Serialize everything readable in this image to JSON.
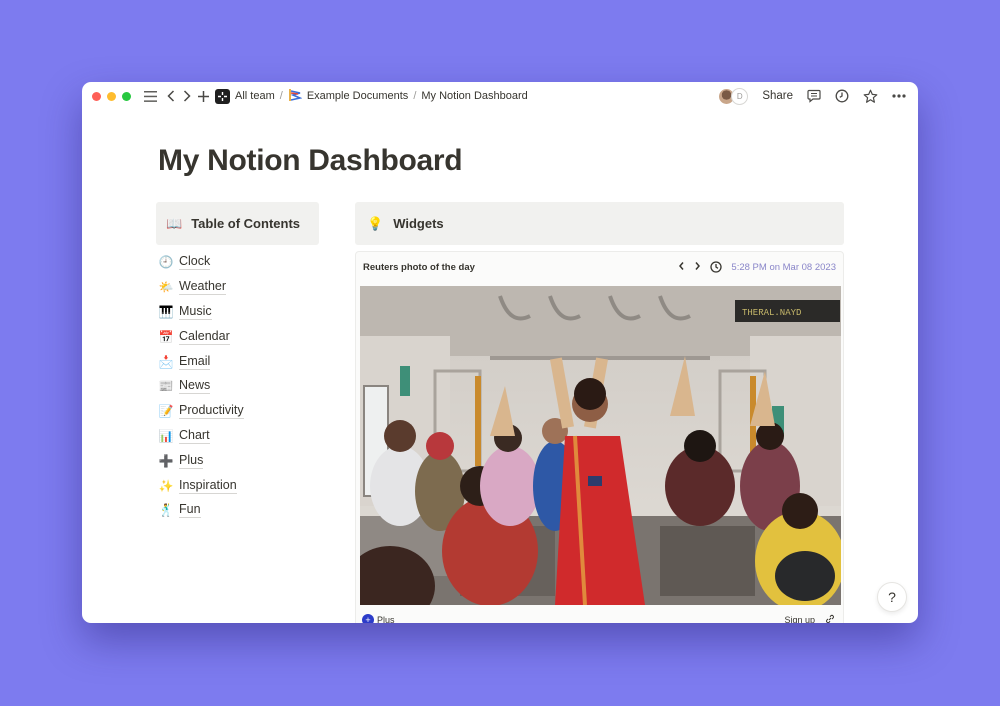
{
  "window": {
    "traffic_lights": [
      "close",
      "minimize",
      "zoom"
    ]
  },
  "titlebar": {
    "breadcrumb": [
      {
        "label": "All team",
        "icon": "workspace-icon"
      },
      {
        "label": "Example Documents",
        "icon": "document-emoji-icon"
      },
      {
        "label": "My Notion Dashboard"
      }
    ],
    "separator": "/",
    "avatar_initial": "D",
    "share_label": "Share",
    "icons": [
      "comment-icon",
      "history-clock-icon",
      "star-icon",
      "more-icon"
    ]
  },
  "page": {
    "title": "My Notion Dashboard"
  },
  "toc": {
    "emoji": "📖",
    "title": "Table of Contents",
    "items": [
      {
        "emoji": "🕘",
        "label": "Clock"
      },
      {
        "emoji": "🌤️",
        "label": "Weather"
      },
      {
        "emoji": "🎹",
        "label": "Music"
      },
      {
        "emoji": "📅",
        "label": "Calendar"
      },
      {
        "emoji": "📩",
        "label": "Email"
      },
      {
        "emoji": "📰",
        "label": "News"
      },
      {
        "emoji": "📝",
        "label": "Productivity"
      },
      {
        "emoji": "📊",
        "label": "Chart"
      },
      {
        "emoji": "➕",
        "label": "Plus"
      },
      {
        "emoji": "✨",
        "label": "Inspiration"
      },
      {
        "emoji": "🕺",
        "label": "Fun"
      }
    ]
  },
  "widgets": {
    "emoji": "💡",
    "title": "Widgets",
    "card": {
      "title": "Reuters photo of the day",
      "prev": "‹",
      "next": "›",
      "timestamp": "5:28 PM on Mar 08 2023",
      "photo_alt": "Women doing yoga poses inside a commuter train car",
      "photo_sign_text": "THERAL.NAYD",
      "footer_left": "Plus",
      "footer_right": "Sign up"
    }
  },
  "help": {
    "label": "?"
  }
}
